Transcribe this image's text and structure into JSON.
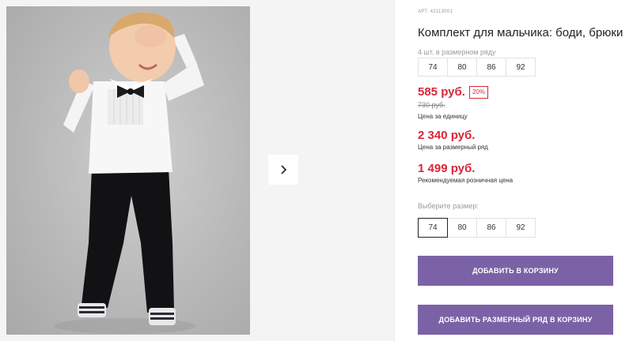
{
  "product": {
    "sku": "АРТ. 42113001",
    "title": "Комплект для мальчика: боди, брюки",
    "image_alt": "boy-in-white-bodysuit-and-black-trousers"
  },
  "pack": {
    "label": "4 шт. в размерном ряду",
    "sizes": [
      "74",
      "80",
      "86",
      "92"
    ]
  },
  "prices": {
    "unit_price": "585 руб.",
    "discount": "20%",
    "old_price": "730 руб.",
    "unit_label": "Цена за единицу",
    "set_price": "2 340 руб.",
    "set_label": "Цена за размерный ряд",
    "rrp_price": "1 499 руб.",
    "rrp_label": "Рекомендуемая розничная цена"
  },
  "size_picker": {
    "label": "Выберите размер:",
    "sizes": [
      "74",
      "80",
      "86",
      "92"
    ],
    "selected": "74"
  },
  "buttons": {
    "add_to_cart": "ДОБАВИТЬ В КОРЗИНУ",
    "add_set_to_cart": "ДОБАВИТЬ РАЗМЕРНЫЙ РЯД В КОРЗИНУ"
  },
  "gallery": {
    "next_icon": "chevron-right-icon"
  },
  "colors": {
    "accent_button": "#7b62a6",
    "price_red": "#d9263a"
  }
}
